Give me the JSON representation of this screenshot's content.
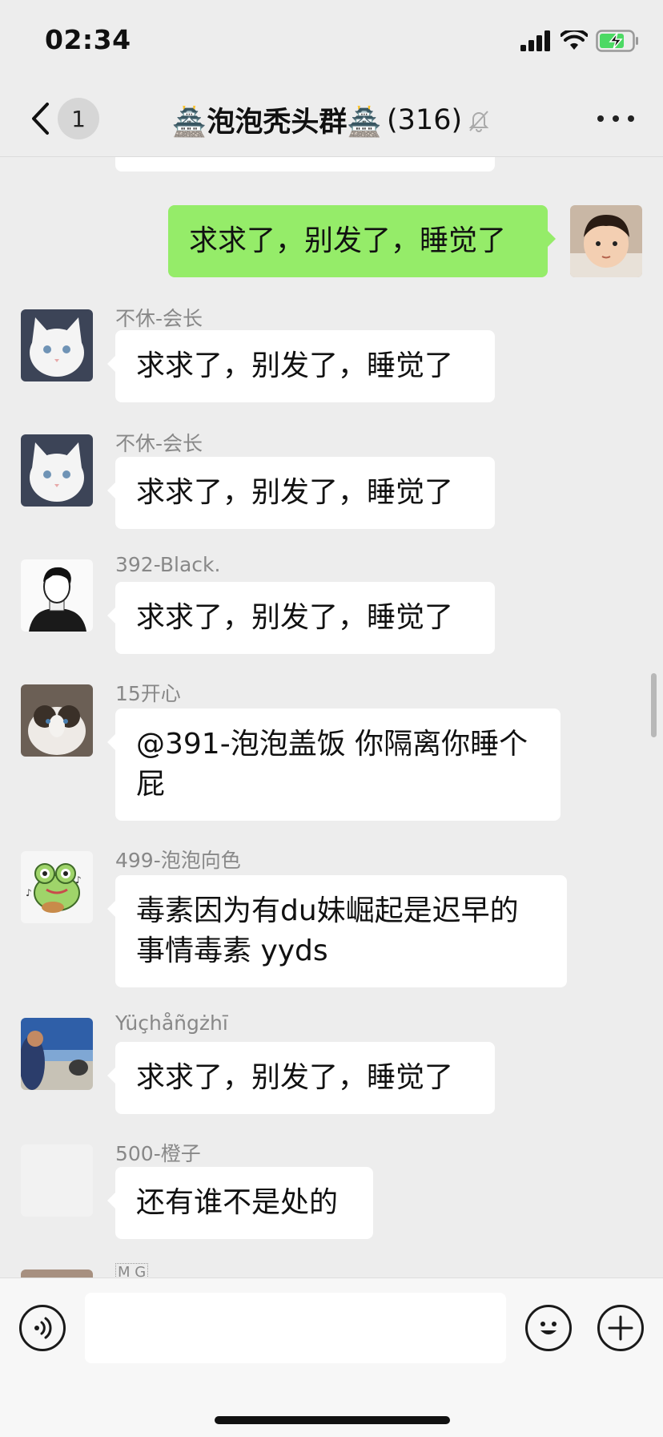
{
  "status_bar": {
    "time": "02:34",
    "battery_color": "#4cd964"
  },
  "nav": {
    "back_icon": "chevron-left-icon",
    "unread_count": "1",
    "title": "🏯泡泡秃头群🏯",
    "member_count": "(316)",
    "muted_icon": "bell-off-icon",
    "more_icon": "ellipsis-icon"
  },
  "messages": [
    {
      "sender": "",
      "text": "求求了，别发了，睡觉了",
      "mine": true,
      "avatar": "toddler-avatar"
    },
    {
      "sender": "不休-会长",
      "text": "求求了，别发了，睡觉了",
      "avatar": "white-cat-avatar"
    },
    {
      "sender": "不休-会长",
      "text": "求求了，别发了，睡觉了",
      "avatar": "white-cat-avatar"
    },
    {
      "sender": "392-Black.",
      "text": "求求了，别发了，睡觉了",
      "avatar": "sketch-man-avatar"
    },
    {
      "sender": "15开心",
      "text_line1": "@391-泡泡盖饭 你隔离你睡个",
      "text_line2": "屁",
      "avatar": "ragdoll-cat-avatar"
    },
    {
      "sender": "499-泡泡向色",
      "text_line1": "毒素因为有du妹崛起是迟早的",
      "text_line2": "事情毒素 yyds",
      "avatar": "frog-avatar"
    },
    {
      "sender": "Yüçhåñgżhī",
      "text": "求求了，别发了，睡觉了",
      "avatar": "landscape-avatar"
    },
    {
      "sender": "500-橙子",
      "text": "还有谁不是处的",
      "avatar": "blank-avatar"
    },
    {
      "sender": "M  G",
      "avatar": "partial-avatar"
    }
  ],
  "input_bar": {
    "voice_icon": "voice-icon",
    "emoji_icon": "emoji-icon",
    "plus_icon": "plus-icon",
    "placeholder": ""
  },
  "colors": {
    "background": "#ededed",
    "my_bubble": "#95ec69",
    "their_bubble": "#ffffff"
  }
}
